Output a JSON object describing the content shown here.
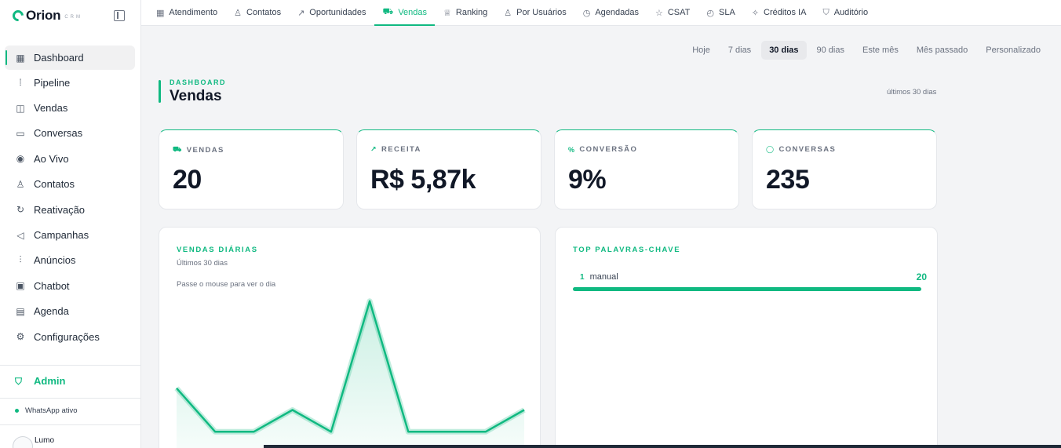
{
  "brand": {
    "name": "Orion",
    "sub": "CRM"
  },
  "sidebar": {
    "items": [
      {
        "label": "Dashboard",
        "icon": "grid-icon"
      },
      {
        "label": "Pipeline",
        "icon": "pipeline-icon"
      },
      {
        "label": "Vendas",
        "icon": "bag-icon"
      },
      {
        "label": "Conversas",
        "icon": "chat-icon"
      },
      {
        "label": "Ao Vivo",
        "icon": "broadcast-icon"
      },
      {
        "label": "Contatos",
        "icon": "users-icon"
      },
      {
        "label": "Reativação",
        "icon": "refresh-icon"
      },
      {
        "label": "Campanhas",
        "icon": "megaphone-icon"
      },
      {
        "label": "Anúncios",
        "icon": "bar-chart-icon"
      },
      {
        "label": "Chatbot",
        "icon": "bot-icon"
      },
      {
        "label": "Agenda",
        "icon": "calendar-icon"
      },
      {
        "label": "Configurações",
        "icon": "gear-icon"
      }
    ],
    "admin_label": "Admin",
    "whatsapp_status": "WhatsApp ativo",
    "user_name": "Lumo"
  },
  "topnav": {
    "tabs": [
      {
        "label": "Atendimento",
        "icon": "grid-icon"
      },
      {
        "label": "Contatos",
        "icon": "users-icon"
      },
      {
        "label": "Oportunidades",
        "icon": "trend-icon"
      },
      {
        "label": "Vendas",
        "icon": "cart-icon"
      },
      {
        "label": "Ranking",
        "icon": "trophy-icon"
      },
      {
        "label": "Por Usuários",
        "icon": "user-icon"
      },
      {
        "label": "Agendadas",
        "icon": "clock-icon"
      },
      {
        "label": "CSAT",
        "icon": "star-icon"
      },
      {
        "label": "SLA",
        "icon": "timer-icon"
      },
      {
        "label": "Créditos IA",
        "icon": "sparkle-icon"
      },
      {
        "label": "Auditório",
        "icon": "shield-icon"
      }
    ]
  },
  "periods": [
    "Hoje",
    "7 dias",
    "30 dias",
    "90 dias",
    "Este mês",
    "Mês passado",
    "Personalizado"
  ],
  "header": {
    "kicker": "DASHBOARD",
    "title": "Vendas",
    "range": "últimos 30 dias"
  },
  "kpis": [
    {
      "label": "VENDAS",
      "value": "20",
      "icon": "cart-icon"
    },
    {
      "label": "RECEITA",
      "value": "R$ 5,87k",
      "icon": "trend-icon"
    },
    {
      "label": "CONVERSÃO",
      "value": "9%",
      "icon": "percent-icon"
    },
    {
      "label": "CONVERSAS",
      "value": "235",
      "icon": "chat-icon"
    }
  ],
  "daily_sales": {
    "title": "VENDAS DIÁRIAS",
    "subtitle": "Últimos 30 dias",
    "hint": "Passe o mouse para ver o dia"
  },
  "top_keywords": {
    "title": "TOP PALAVRAS-CHAVE",
    "items": [
      {
        "rank": "1",
        "label": "manual",
        "value": "20",
        "fraction": 1.0
      }
    ]
  },
  "colors": {
    "accent": "#10b981",
    "text": "#111827",
    "muted": "#6b7280"
  },
  "chart_data": {
    "type": "area",
    "x": [
      1,
      2,
      3,
      4,
      5,
      6,
      7,
      8,
      9,
      10
    ],
    "series": [
      {
        "values": [
          3,
          1,
          1,
          2,
          1,
          7,
          1,
          1,
          1,
          2
        ]
      }
    ],
    "ylim": [
      0,
      8
    ],
    "grid": false
  }
}
